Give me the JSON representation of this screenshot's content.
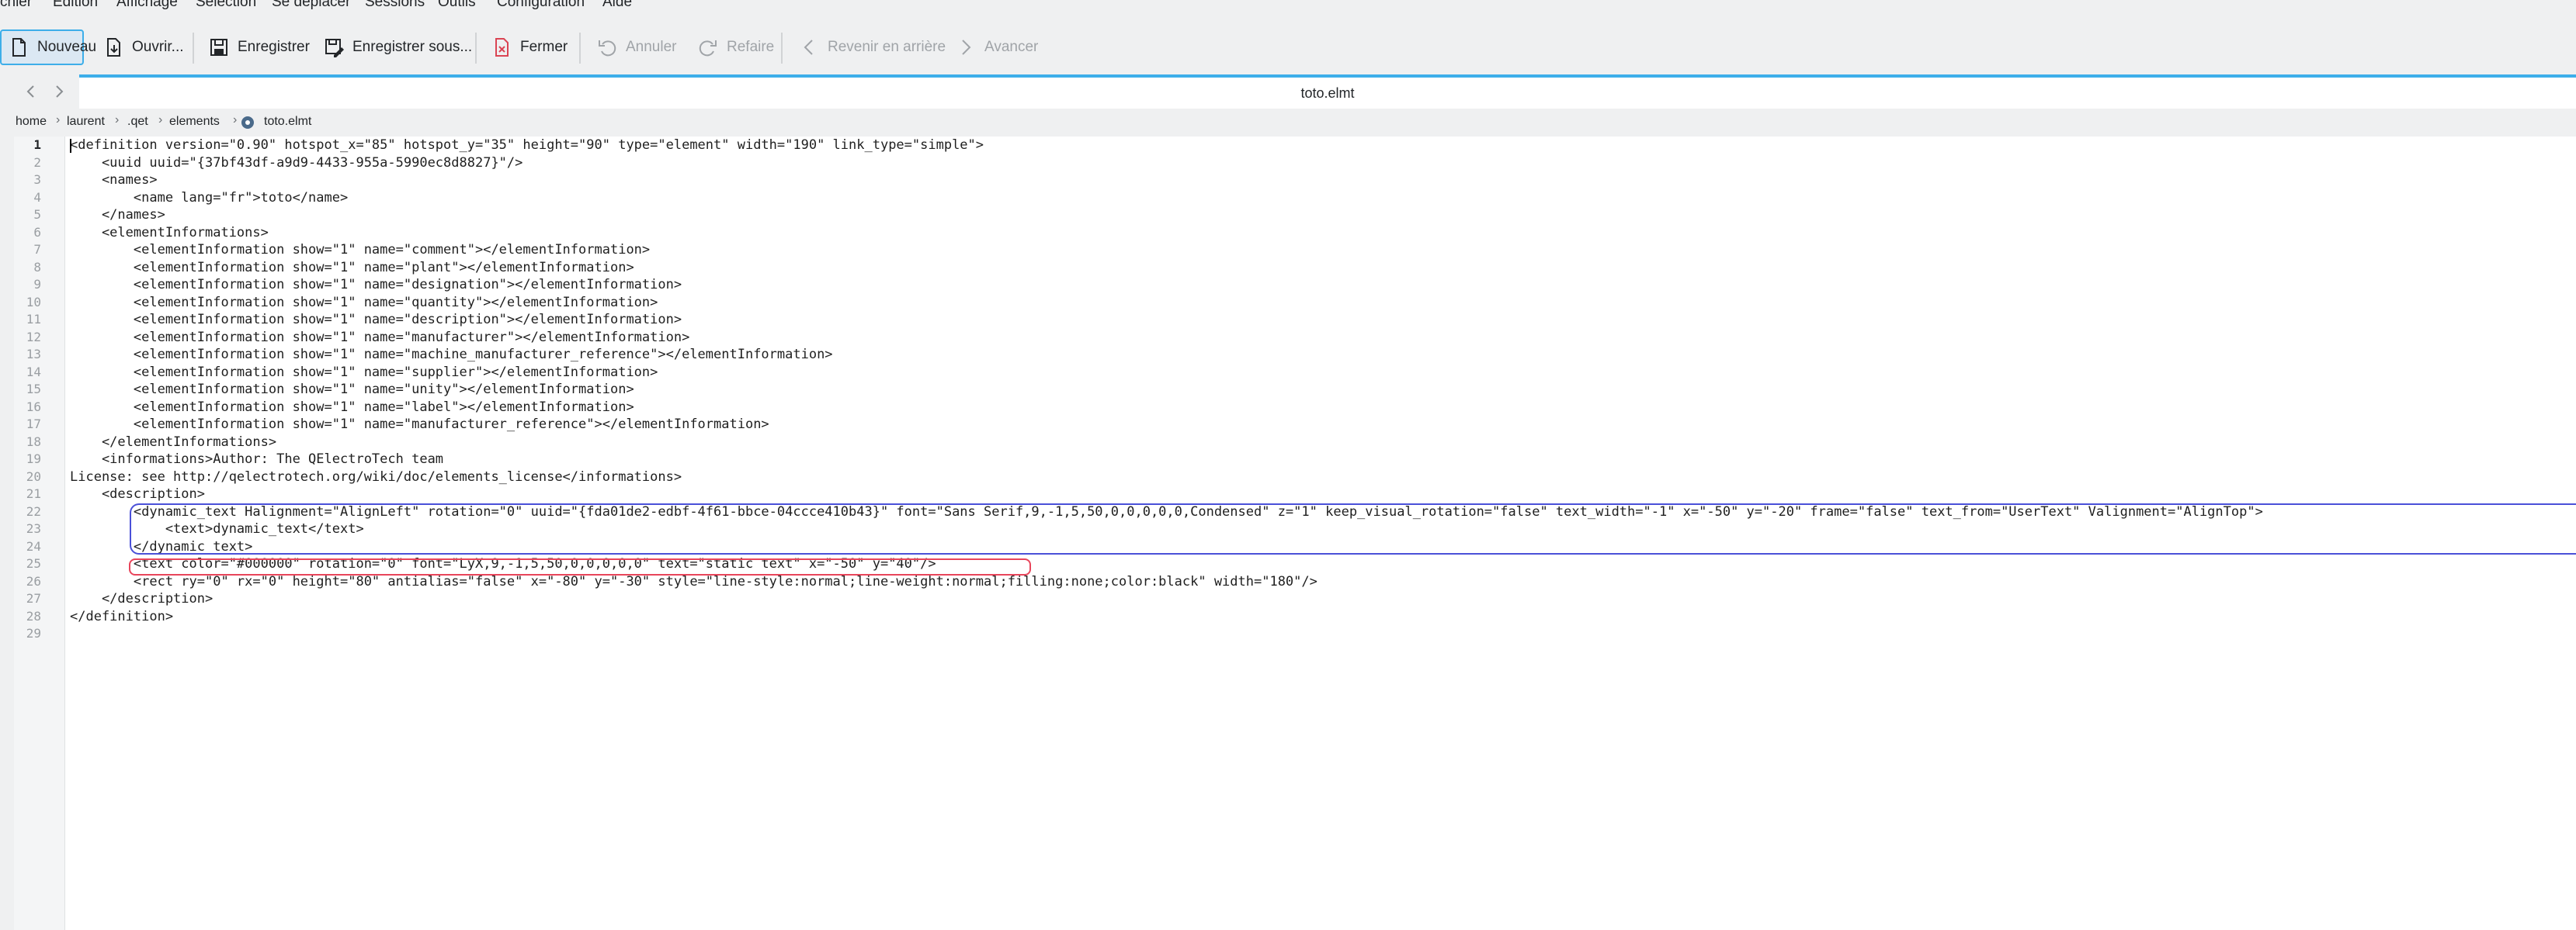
{
  "menu": [
    "chier",
    "Édition",
    "Affichage",
    "Sélection",
    "Se déplacer",
    "Sessions",
    "Outils",
    "Configuration",
    "Aide"
  ],
  "toolbar": {
    "new_label": "Nouveau",
    "open_label": "Ouvrir...",
    "save_label": "Enregistrer",
    "save_as_label": "Enregistrer sous...",
    "close_label": "Fermer",
    "undo_label": "Annuler",
    "redo_label": "Refaire",
    "back_label": "Revenir en arrière",
    "forward_label": "Avancer"
  },
  "tab": {
    "title": "toto.elmt"
  },
  "breadcrumb": [
    "home",
    "laurent",
    ".qet",
    "elements",
    "toto.elmt"
  ],
  "editor": {
    "current_line": 1,
    "lines": [
      "<definition version=\"0.90\" hotspot_x=\"85\" hotspot_y=\"35\" height=\"90\" type=\"element\" width=\"190\" link_type=\"simple\">",
      "    <uuid uuid=\"{37bf43df-a9d9-4433-955a-5990ec8d8827}\"/>",
      "    <names>",
      "        <name lang=\"fr\">toto</name>",
      "    </names>",
      "    <elementInformations>",
      "        <elementInformation show=\"1\" name=\"comment\"></elementInformation>",
      "        <elementInformation show=\"1\" name=\"plant\"></elementInformation>",
      "        <elementInformation show=\"1\" name=\"designation\"></elementInformation>",
      "        <elementInformation show=\"1\" name=\"quantity\"></elementInformation>",
      "        <elementInformation show=\"1\" name=\"description\"></elementInformation>",
      "        <elementInformation show=\"1\" name=\"manufacturer\"></elementInformation>",
      "        <elementInformation show=\"1\" name=\"machine_manufacturer_reference\"></elementInformation>",
      "        <elementInformation show=\"1\" name=\"supplier\"></elementInformation>",
      "        <elementInformation show=\"1\" name=\"unity\"></elementInformation>",
      "        <elementInformation show=\"1\" name=\"label\"></elementInformation>",
      "        <elementInformation show=\"1\" name=\"manufacturer_reference\"></elementInformation>",
      "    </elementInformations>",
      "    <informations>Author: The QElectroTech team",
      "License: see http://qelectrotech.org/wiki/doc/elements_license</informations>",
      "    <description>",
      "        <dynamic_text Halignment=\"AlignLeft\" rotation=\"0\" uuid=\"{fda01de2-edbf-4f61-bbce-04ccce410b43}\" font=\"Sans Serif,9,-1,5,50,0,0,0,0,0,Condensed\" z=\"1\" keep_visual_rotation=\"false\" text_width=\"-1\" x=\"-50\" y=\"-20\" frame=\"false\" text_from=\"UserText\" Valignment=\"AlignTop\">",
      "            <text>dynamic_text</text>",
      "        </dynamic_text>",
      "        <text color=\"#000000\" rotation=\"0\" font=\"LyX,9,-1,5,50,0,0,0,0,0\" text=\"static text\" x=\"-50\" y=\"40\"/>",
      "        <rect ry=\"0\" rx=\"0\" height=\"80\" antialias=\"false\" x=\"-80\" y=\"-30\" style=\"line-style:normal;line-weight:normal;filling:none;color:black\" width=\"180\"/>",
      "    </description>",
      "</definition>",
      ""
    ]
  },
  "annotations": {
    "blue_box_lines": "22-24",
    "blue_color": "#4a50d8",
    "red_box_line": "25",
    "red_color": "#e8455b"
  },
  "colors": {
    "accent": "#3daee9",
    "toolbar_bg": "#eff0f1",
    "close_icon": "#da4453"
  }
}
